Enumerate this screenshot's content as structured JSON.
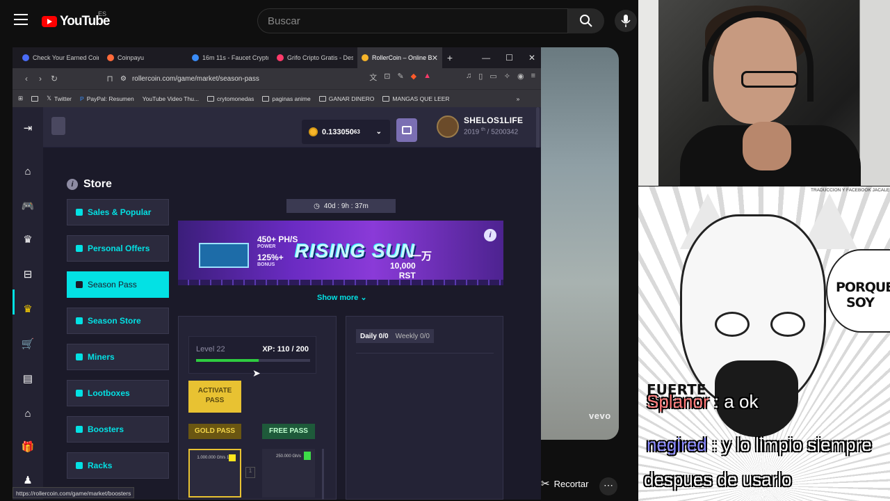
{
  "youtube": {
    "logo": "YouTube",
    "region": "ES",
    "search_placeholder": "Buscar"
  },
  "browser": {
    "tabs": [
      {
        "label": "Check Your Earned Coin",
        "color": "#4a6cf7"
      },
      {
        "label": "Coinpayu",
        "color": "#ff6a3a"
      },
      {
        "label": "16m 11s - Faucet Crypto",
        "color": "#3a8cf7"
      },
      {
        "label": "Grifo Cripto Gratis - Des",
        "color": "#ff3a6a"
      },
      {
        "label": "RollerCoin – Online B",
        "color": "#f7b52a",
        "active": true
      }
    ],
    "url": "rollercoin.com/game/market/season-pass",
    "bookmarks": [
      "Twitter",
      "PayPal: Resumen",
      "YouTube Video Thu...",
      "crytomonedas",
      "paginas anime",
      "GANAR DINERO",
      "MANGAS QUE LEER"
    ],
    "status_url": "https://rollercoin.com/game/market/boosters"
  },
  "rollercoin": {
    "balance": "0.133050",
    "balance_small": "63",
    "username": "SHELOS1LIFE",
    "rank": "2019",
    "rank_sup": "th",
    "rank_total": "/ 5200342",
    "store_title": "Store",
    "menu": [
      {
        "label": "Sales & Popular"
      },
      {
        "label": "Personal Offers"
      },
      {
        "label": "Season Pass",
        "active": true
      },
      {
        "label": "Season Store"
      },
      {
        "label": "Miners"
      },
      {
        "label": "Lootboxes"
      },
      {
        "label": "Boosters"
      },
      {
        "label": "Racks"
      }
    ],
    "timer": "40d : 9h : 37m",
    "banner": {
      "power": "450+ PH/S",
      "power_label": "POWER",
      "bonus": "125%+",
      "bonus_label": "BONUS",
      "title": "RISING SUN",
      "chinese": "一万",
      "rst": "10,000",
      "rst_label": "RST"
    },
    "show_more": "Show more",
    "level": "Level 22",
    "xp": "XP: 110 / 200",
    "xp_progress": 0.55,
    "activate_pass": "ACTIVATE PASS",
    "gold_pass": "GOLD PASS",
    "free_pass": "FREE PASS",
    "gold_card_text": "1.000.000 Gh/s 1%",
    "free_card_text": "250.000 Gh/s",
    "daily": "Daily 0/0",
    "weekly": "Weekly 0/0"
  },
  "video": {
    "vevo": "vevo",
    "clip_label": "Recortar"
  },
  "manga": {
    "credit": "TRADUCCION Y FACEBOOK JACALE",
    "bubble": "PORQUE SOY",
    "sfx": "FUERTE"
  },
  "chat": [
    {
      "user": "Splanor",
      "msg": " : a ok"
    },
    {
      "user": "negired",
      "msg": " : y lo limpio siempre"
    },
    {
      "user": "",
      "msg": "despues de usarlo"
    }
  ]
}
